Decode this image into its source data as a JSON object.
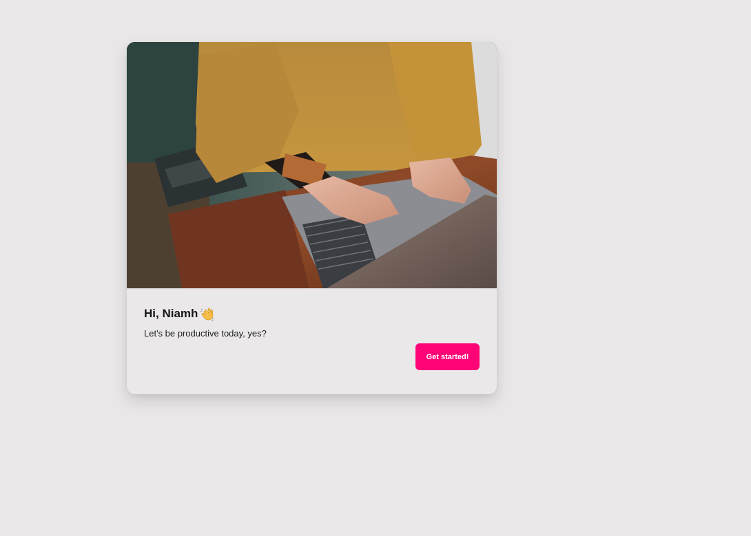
{
  "card": {
    "greeting": "Hi, Niamh",
    "greeting_icon": "waving-hand-icon",
    "subtitle": "Let's be productive today, yes?",
    "cta_label": "Get started!",
    "hero_image": "person-typing-on-laptop-photo"
  },
  "colors": {
    "background": "#e9e7e8",
    "card": "#eae8e9",
    "accent": "#fd0477"
  }
}
